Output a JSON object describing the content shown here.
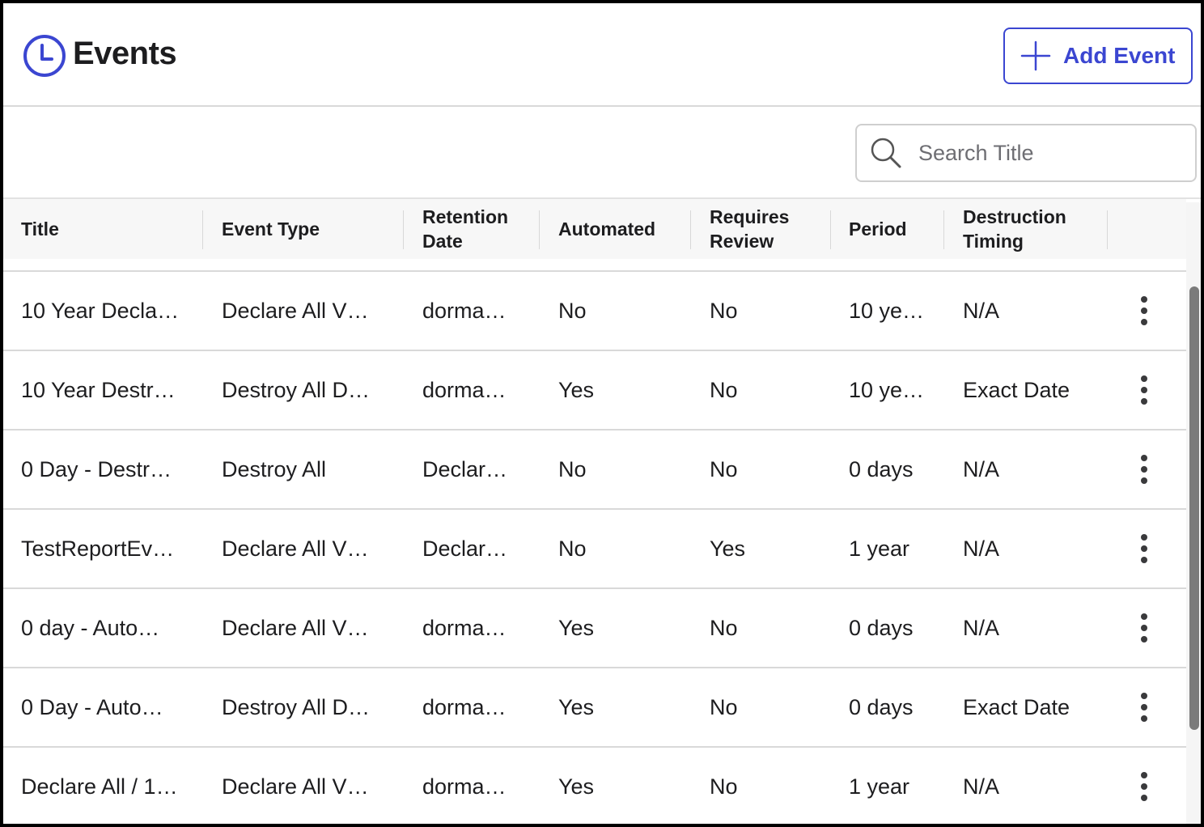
{
  "header": {
    "title": "Events",
    "add_button_label": "Add Event"
  },
  "search": {
    "placeholder": "Search Title",
    "value": ""
  },
  "table": {
    "columns": [
      "Title",
      "Event Type",
      "Retention Date",
      "Automated",
      "Requires Review",
      "Period",
      "Destruction Timing"
    ],
    "column_lines": [
      [
        "Title"
      ],
      [
        "Event Type"
      ],
      [
        "Retention",
        "Date"
      ],
      [
        "Automated"
      ],
      [
        "Requires",
        "Review"
      ],
      [
        "Period"
      ],
      [
        "Destruction",
        "Timing"
      ]
    ],
    "rows": [
      [
        "10 Year Decla…",
        "Declare All V…",
        "dorma…",
        "No",
        "No",
        "10 ye…",
        "N/A"
      ],
      [
        "10 Year Destr…",
        "Destroy All D…",
        "dorma…",
        "Yes",
        "No",
        "10 ye…",
        "Exact Date"
      ],
      [
        "0 Day - Destr…",
        "Destroy All",
        "Declar…",
        "No",
        "No",
        "0 days",
        "N/A"
      ],
      [
        "TestReportEv…",
        "Declare All V…",
        "Declar…",
        "No",
        "Yes",
        "1 year",
        "N/A"
      ],
      [
        "0 day - Auto…",
        "Declare All V…",
        "dorma…",
        "Yes",
        "No",
        "0 days",
        "N/A"
      ],
      [
        "0 Day - Auto…",
        "Destroy All D…",
        "dorma…",
        "Yes",
        "No",
        "0 days",
        "Exact Date"
      ],
      [
        "Declare All / 1…",
        "Declare All V…",
        "dorma…",
        "Yes",
        "No",
        "1 year",
        "N/A"
      ]
    ]
  },
  "icons": {
    "title_icon": "clock-icon",
    "add_icon": "plus-icon",
    "search_icon": "search-icon",
    "row_action_icon": "kebab-menu-icon"
  },
  "colors": {
    "accent": "#3b46d1",
    "text": "#1d1d1f",
    "border": "#d9d9d9"
  }
}
